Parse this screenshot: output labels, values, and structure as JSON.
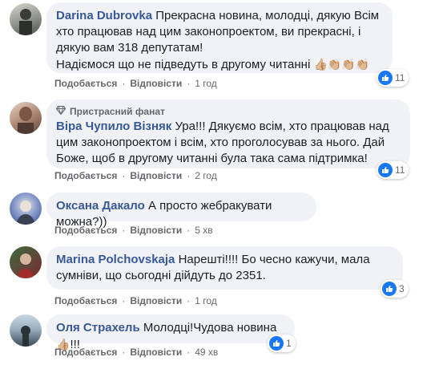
{
  "comments": [
    {
      "author": "Darina Dubrovka",
      "text": "Прекрасна новина, молодці, дякую Всім хто працював над цим законопроектом, ви прекрасні, і дякую вам 318 депутатам!",
      "text2": "Надіємося що не підведуть в другому читанні",
      "emojis": "👍🏼👏🏼👏🏼👏🏼",
      "like_label": "Подобається",
      "reply_label": "Відповісти",
      "time": "1 год",
      "reaction_count": "11",
      "avatar_colors": [
        "#6b6f6a",
        "#d8d6cf"
      ]
    },
    {
      "badge": "Пристрасний фанат",
      "author": "Віра Чупило Візняк",
      "text": "Ура!!! Дякуємо всім, хто працював над цим законопроектом і всім, хто проголосував за нього. Дай Боже, щоб в другому читанні була така сама підтримка!",
      "like_label": "Подобається",
      "reply_label": "Відповісти",
      "time": "2 год",
      "reaction_count": "11",
      "avatar_colors": [
        "#b08a77",
        "#5e4438"
      ]
    },
    {
      "author": "Оксана Дакало",
      "text": "А просто жебракувати можна?))",
      "like_label": "Подобається",
      "reply_label": "Відповісти",
      "time": "5 хв",
      "avatar_colors": [
        "#3c5aa8",
        "#c3c9d8"
      ]
    },
    {
      "author": "Marina Polchovskaja",
      "text": "Нарешті!!!! Бо чесно кажучи, мала сумніви, що сьогодні дійдуть до 2351.",
      "like_label": "Подобається",
      "reply_label": "Відповісти",
      "time": "1 год",
      "reaction_count": "3",
      "avatar_colors": [
        "#7a2a2a",
        "#3a6b3a"
      ]
    },
    {
      "author": "Оля Страхель",
      "text": "Молодці!Чудова новина",
      "emoji_after": "👍🏼",
      "text_after": "!!!",
      "like_label": "Подобається",
      "reply_label": "Відповісти",
      "time": "49 хв",
      "reaction_count": "1",
      "avatar_colors": [
        "#9bb0c2",
        "#3b4a55"
      ]
    }
  ],
  "colors": {
    "author": "#385898",
    "like_blue": "#1877f2",
    "bubble_bg": "#f0f2f5",
    "meta_gray": "#65676b"
  }
}
